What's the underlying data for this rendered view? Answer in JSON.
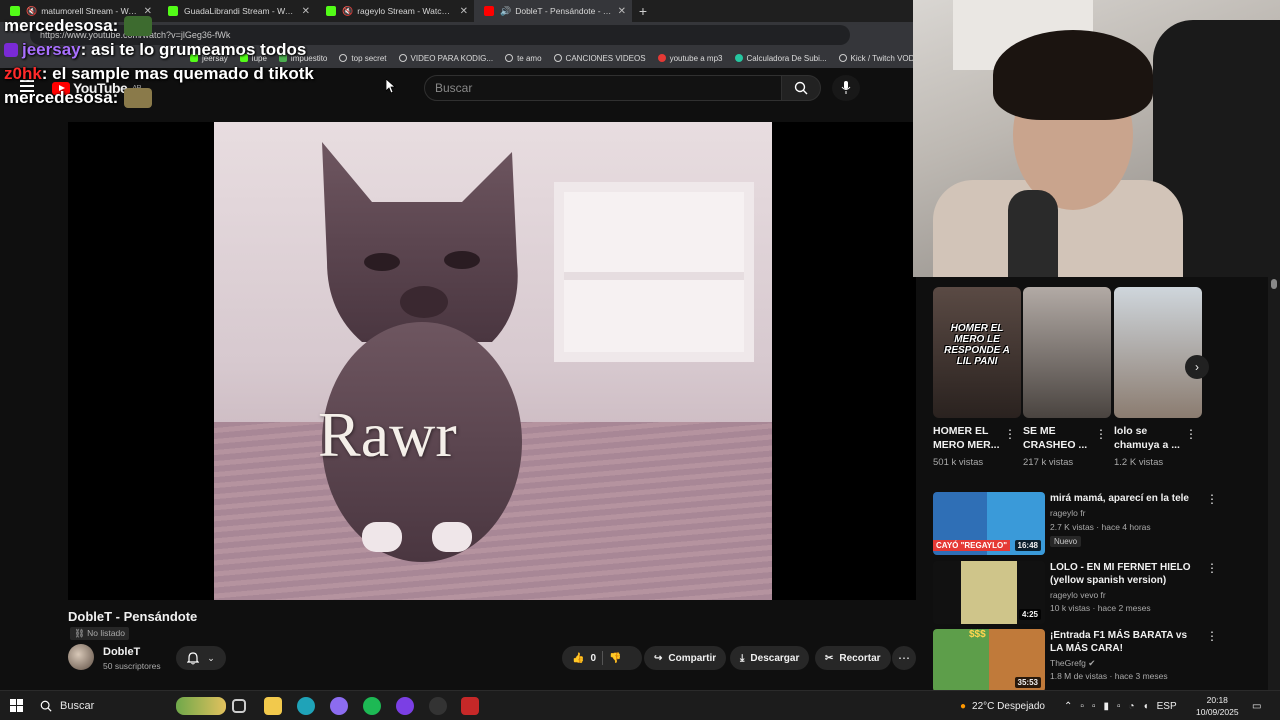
{
  "browser": {
    "tabs": [
      {
        "title": "matumorell Stream - Watch Li",
        "favicon": "kick",
        "muted": true,
        "active": false
      },
      {
        "title": "GuadaLibrandi Stream - Watch Li",
        "favicon": "kick",
        "muted": false,
        "active": false
      },
      {
        "title": "rageylo Stream - Watch Live",
        "favicon": "kick",
        "muted": true,
        "active": false
      },
      {
        "title": "DobleT - Pensándote - YouTu",
        "favicon": "youtube",
        "muted": false,
        "active": true
      }
    ],
    "new_tab": "+",
    "url": "https://www.youtube.com/watch?v=jlGeg36-fWk",
    "bookmarks": [
      "jeersay",
      "lupe",
      "impuestito",
      "top secret",
      "VIDEO PARA KODIG...",
      "te amo",
      "CANCIONES VIDEOS",
      "youtube a mp3",
      "Calculadora De Subi...",
      "Kick / Twitch VOD"
    ]
  },
  "chat": [
    {
      "user": "mercedesosa:",
      "message": "",
      "color": "#ffffff"
    },
    {
      "user": "jeersay",
      "message": ": asi te lo grumeamos todos",
      "color": "#a970ff"
    },
    {
      "user": "z0hk",
      "message": ": el sample mas quemado d tikotk",
      "color": "#ff2a2a"
    },
    {
      "user": "mercedesosa:",
      "message": "",
      "color": "#ffffff"
    }
  ],
  "youtube": {
    "logo": "YouTube",
    "region": "AR",
    "search_placeholder": "Buscar",
    "video": {
      "overlay_text": "Rawr",
      "title": "DobleT - Pensándote",
      "visibility": "No listado",
      "channel": "DobleT",
      "subscribers": "50 suscriptores",
      "likes": "0",
      "share": "Compartir",
      "download": "Descargar",
      "clip": "Recortar"
    },
    "shorts": [
      {
        "caption": "HOMER EL MERO LE RESPONDE A LIL PANI",
        "title": "HOMER EL MERO MER...",
        "views": "501 k vistas"
      },
      {
        "caption": "",
        "title": "SE ME CRASHEO ...",
        "views": "217 k vistas"
      },
      {
        "caption": "",
        "title": "lolo se chamuya a ...",
        "views": "1.2 K vistas"
      }
    ],
    "recommendations": [
      {
        "title": "mirá mamá, aparecí en la tele",
        "channel": "rageylo fr",
        "meta": "2.7 K vistas · hace 4 horas",
        "badge": "Nuevo",
        "duration": "16:48",
        "thumb_text": "CAYÓ \"REGAYLO\""
      },
      {
        "title": "LOLO - EN MI FERNET HIELO (yellow spanish version)",
        "channel": "rageylo vevo fr",
        "meta": "10 k vistas · hace 2 meses",
        "badge": "",
        "duration": "4:25",
        "thumb_text": ""
      },
      {
        "title": "¡Entrada F1 MÁS BARATA vs LA MÁS CARA!",
        "channel": "TheGrefg",
        "meta": "1.8 M de vistas · hace 3 meses",
        "badge": "",
        "duration": "35:53",
        "thumb_text": "$$$"
      }
    ]
  },
  "taskbar": {
    "search": "Buscar",
    "weather": "22°C  Despejado",
    "language": "ESP",
    "time": "20:18",
    "date": "10/09/2025"
  },
  "colors": {
    "background": "#0f0f0f",
    "youtube_red": "#ff0000",
    "kick_green": "#53fc18"
  }
}
